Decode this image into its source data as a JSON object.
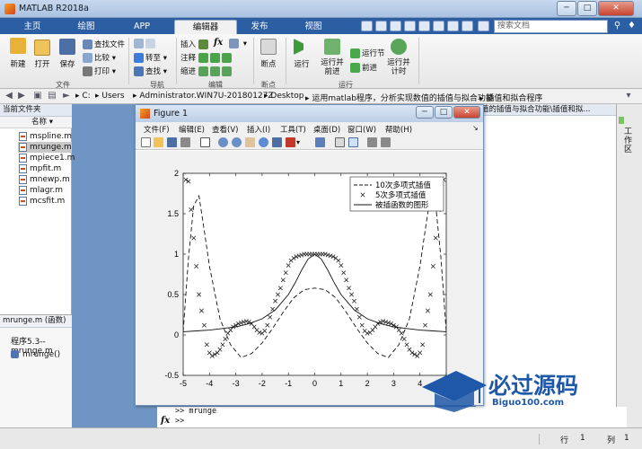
{
  "window": {
    "title": "MATLAB R2018a",
    "minimize": "─",
    "maximize": "□",
    "close": "✕"
  },
  "tabs": [
    {
      "label": "主页",
      "active": false
    },
    {
      "label": "绘图",
      "active": false
    },
    {
      "label": "APP",
      "active": false
    },
    {
      "label": "编辑器",
      "active": true
    },
    {
      "label": "发布",
      "active": false
    },
    {
      "label": "视图",
      "active": false
    }
  ],
  "search": {
    "placeholder": "搜索文档"
  },
  "toolstrip": {
    "file": {
      "new": "新建",
      "open": "打开",
      "save": "保存",
      "find_files": "查找文件",
      "compare": "比较",
      "print": "打印",
      "group": "文件"
    },
    "navigate": {
      "goto": "转至",
      "find": "查找",
      "group": "导航"
    },
    "edit": {
      "insert": "插入",
      "comment": "注释",
      "indent": "缩进",
      "fx": "fx",
      "group": "编辑"
    },
    "breakpoints": {
      "label": "断点",
      "group": "断点"
    },
    "run": {
      "run": "运行",
      "run_advance_1": "运行并",
      "run_advance_2": "前进",
      "run_section": "运行节",
      "advance": "前进",
      "run_time_1": "运行并",
      "run_time_2": "计时",
      "group": "运行"
    }
  },
  "address": {
    "crumbs": [
      "C:",
      "Users",
      "Administrator.WIN7U-20180127Z",
      "Desktop",
      "运用matlab程序，分析实现数值的插值与拟合功能",
      "插值和拟合程序"
    ]
  },
  "left_panel": {
    "header": "当前文件夹",
    "name_col": "名称",
    "files": [
      {
        "name": "mspline.m",
        "selected": false
      },
      {
        "name": "mrunge.m",
        "selected": true
      },
      {
        "name": "mpiece1.m",
        "selected": false
      },
      {
        "name": "mpfit.m",
        "selected": false
      },
      {
        "name": "mnewp.m",
        "selected": false
      },
      {
        "name": "mlagr.m",
        "selected": false
      },
      {
        "name": "mcsfit.m",
        "selected": false
      }
    ],
    "details_header": "mrunge.m  (函数)",
    "details_desc": "程序5.3--mrunge.m",
    "details_fn": "mrunge()"
  },
  "editor_header": "值的插值与拟合功能\\插值和拟...",
  "right_strip": "工作区",
  "command": {
    "line1": ">> mrunge",
    "prompt": "fx",
    "line2": ">>"
  },
  "status": {
    "row_label": "行",
    "row": "1",
    "col_label": "列",
    "col": "1"
  },
  "figure": {
    "title": "Figure 1",
    "menu": [
      "文件(F)",
      "编辑(E)",
      "查看(V)",
      "插入(I)",
      "工具(T)",
      "桌面(D)",
      "窗口(W)",
      "帮助(H)"
    ]
  },
  "watermark": {
    "title": "必过源码",
    "sub": "Biguo100.com"
  },
  "colors": {
    "ribbon_blue": "#2c5ea4",
    "selected_row": "#c8c8c8",
    "watermark_blue": "#1f58a8"
  },
  "chart_data": {
    "type": "line",
    "xlim": [
      -5,
      5
    ],
    "ylim": [
      -0.5,
      2
    ],
    "xticks": [
      -5,
      -4,
      -3,
      -2,
      -1,
      0,
      1,
      2,
      3,
      4,
      5
    ],
    "yticks": [
      -0.5,
      0,
      0.5,
      1,
      1.5,
      2
    ],
    "legend_position": "top-right",
    "series": [
      {
        "name": "10次多项式插值",
        "style": "dashed",
        "x": [
          -5,
          -4.8,
          -4.6,
          -4.4,
          -4.2,
          -4,
          -3.6,
          -3.2,
          -2.8,
          -2.4,
          -2,
          -1.6,
          -1.2,
          -0.8,
          -0.4,
          0,
          0.4,
          0.8,
          1.2,
          1.6,
          2,
          2.4,
          2.8,
          3.2,
          3.6,
          4,
          4.2,
          4.4,
          4.6,
          4.8,
          5
        ],
        "y": [
          0.04,
          0.95,
          1.6,
          1.72,
          1.3,
          0.85,
          0.2,
          -0.12,
          -0.28,
          -0.23,
          -0.1,
          0.08,
          0.28,
          0.46,
          0.56,
          0.58,
          0.56,
          0.46,
          0.28,
          0.08,
          -0.1,
          -0.23,
          -0.28,
          -0.12,
          0.2,
          0.85,
          1.3,
          1.72,
          1.6,
          0.95,
          0.04
        ]
      },
      {
        "name": "5次多项式插值",
        "style": "markers-x",
        "x": [
          -4.9,
          -4.8,
          -4.7,
          -4.6,
          -4.5,
          -4.4,
          -4.3,
          -4.2,
          -4.1,
          -4.0,
          -3.9,
          -3.8,
          -3.7,
          -3.6,
          -3.5,
          -3.4,
          -3.3,
          -3.2,
          -3.1,
          -3.0,
          -2.9,
          -2.8,
          -2.7,
          -2.6,
          -2.5,
          -2.4,
          -2.3,
          -2.2,
          -2.1,
          -2.0,
          -1.9,
          -1.8,
          -1.7,
          -1.6,
          -1.5,
          -1.4,
          -1.3,
          -1.2,
          -1.1,
          -1.0,
          -0.9,
          -0.8,
          -0.7,
          -0.6,
          -0.5,
          -0.4,
          -0.3,
          -0.2,
          -0.1,
          0,
          0.1,
          0.2,
          0.3,
          0.4,
          0.5,
          0.6,
          0.7,
          0.8,
          0.9,
          1.0,
          1.1,
          1.2,
          1.3,
          1.4,
          1.5,
          1.6,
          1.7,
          1.8,
          1.9,
          2.0,
          2.1,
          2.2,
          2.3,
          2.4,
          2.5,
          2.6,
          2.7,
          2.8,
          2.9,
          3.0,
          3.1,
          3.2,
          3.3,
          3.4,
          3.5,
          3.6,
          3.7,
          3.8,
          3.9,
          4.0,
          4.1,
          4.2,
          4.3,
          4.4,
          4.5,
          4.6,
          4.7,
          4.8,
          4.9
        ],
        "y": [
          1.92,
          1.9,
          1.55,
          1.2,
          0.85,
          0.5,
          0.3,
          0.12,
          -0.12,
          -0.22,
          -0.26,
          -0.24,
          -0.22,
          -0.18,
          -0.12,
          -0.05,
          0.02,
          0.06,
          0.1,
          0.12,
          0.14,
          0.15,
          0.16,
          0.17,
          0.16,
          0.14,
          0.1,
          0.06,
          0.03,
          0.02,
          0.05,
          0.12,
          0.22,
          0.32,
          0.42,
          0.5,
          0.58,
          0.68,
          0.77,
          0.86,
          0.92,
          0.95,
          0.97,
          0.98,
          0.99,
          1,
          1,
          1,
          1,
          1,
          1,
          1,
          1,
          1,
          0.99,
          0.98,
          0.97,
          0.95,
          0.92,
          0.86,
          0.77,
          0.68,
          0.58,
          0.5,
          0.42,
          0.32,
          0.22,
          0.12,
          0.05,
          0.02,
          0.03,
          0.06,
          0.1,
          0.14,
          0.16,
          0.17,
          0.16,
          0.15,
          0.14,
          0.12,
          0.1,
          0.06,
          0.02,
          -0.05,
          -0.12,
          -0.18,
          -0.22,
          -0.24,
          -0.26,
          -0.22,
          -0.12,
          0.12,
          0.3,
          0.5,
          0.85,
          1.2,
          1.55,
          1.9,
          1.92
        ]
      },
      {
        "name": "被插函数的图形",
        "style": "solid",
        "x": [
          -5,
          -4.5,
          -4,
          -3.5,
          -3,
          -2.5,
          -2,
          -1.5,
          -1,
          -0.75,
          -0.5,
          -0.25,
          0,
          0.25,
          0.5,
          0.75,
          1,
          1.5,
          2,
          2.5,
          3,
          3.5,
          4,
          4.5,
          5
        ],
        "y": [
          0.04,
          0.05,
          0.06,
          0.08,
          0.1,
          0.14,
          0.2,
          0.31,
          0.5,
          0.64,
          0.8,
          0.94,
          1,
          0.94,
          0.8,
          0.64,
          0.5,
          0.31,
          0.2,
          0.14,
          0.1,
          0.08,
          0.06,
          0.05,
          0.04
        ]
      }
    ]
  }
}
